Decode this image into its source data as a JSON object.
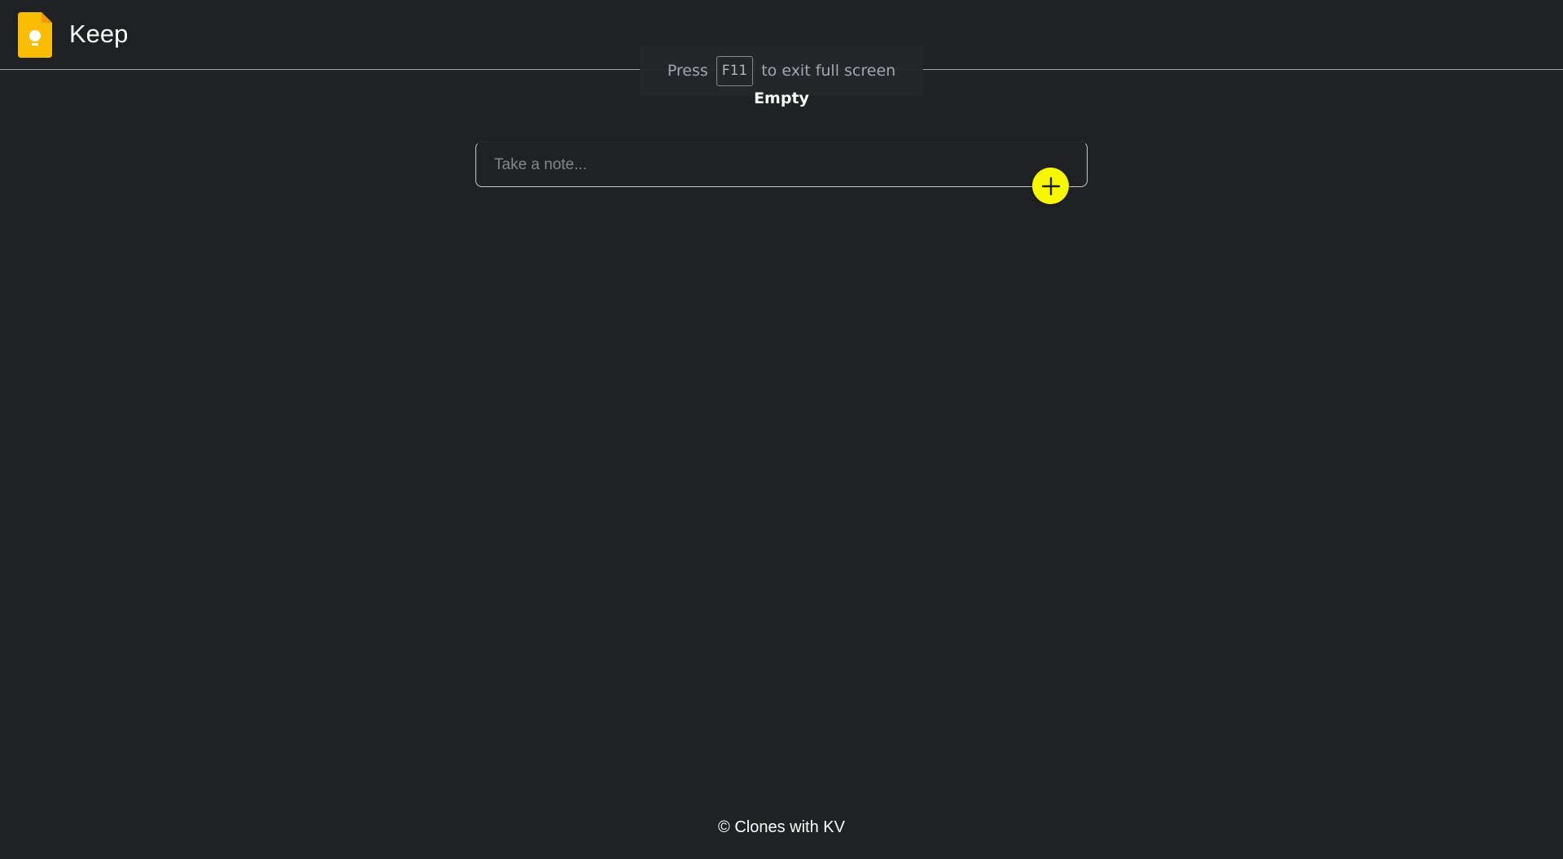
{
  "header": {
    "title": "Keep",
    "logo_icon": "keep-lightbulb-logo",
    "logo_color": "#fbbc04"
  },
  "fullscreen_notice": {
    "prefix": "Press",
    "key": "F11",
    "suffix": "to exit full screen"
  },
  "notes": {
    "empty_label": "Empty"
  },
  "composer": {
    "placeholder": "Take a note...",
    "add_icon": "plus-icon",
    "add_button_color": "#f7f700"
  },
  "footer": {
    "text": "© Clones with KV"
  }
}
